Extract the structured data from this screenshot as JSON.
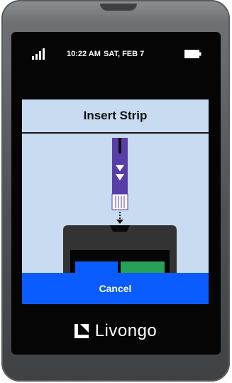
{
  "status": {
    "time": "10:22 AM",
    "date": "SAT, FEB 7",
    "signal_icon": "signal-bars-icon",
    "battery_icon": "battery-icon"
  },
  "screen": {
    "title": "Insert Strip",
    "illustration": "insert-strip-illustration",
    "cancel_label": "Cancel"
  },
  "brand": {
    "logo_icon": "livongo-logo-icon",
    "name": "Livongo"
  },
  "colors": {
    "screen_background": "#c8dbf0",
    "primary_blue": "#0a5cff",
    "strip_purple": "#5a3ea8",
    "meter_green": "#27a05a",
    "meter_body": "#333333"
  }
}
